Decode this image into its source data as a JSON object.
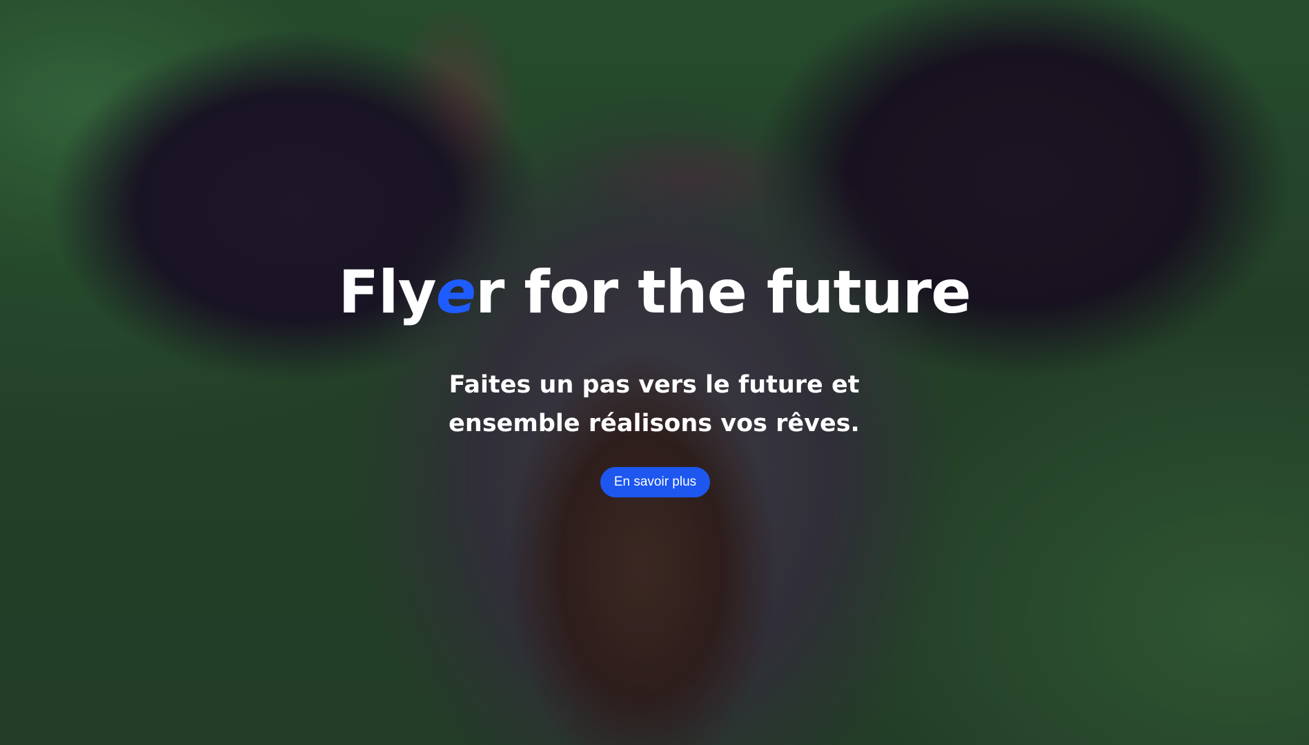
{
  "hero": {
    "title_part1": "Fly",
    "title_accent": "e",
    "title_part2": "r for the future",
    "subtitle_line1": "Faites un pas vers le future et",
    "subtitle_line2": "ensemble réalisons vos rêves.",
    "cta_label": "En savoir plus"
  },
  "colors": {
    "accent": "#1f5cff",
    "button": "#1d57f0",
    "text": "#ffffff"
  }
}
